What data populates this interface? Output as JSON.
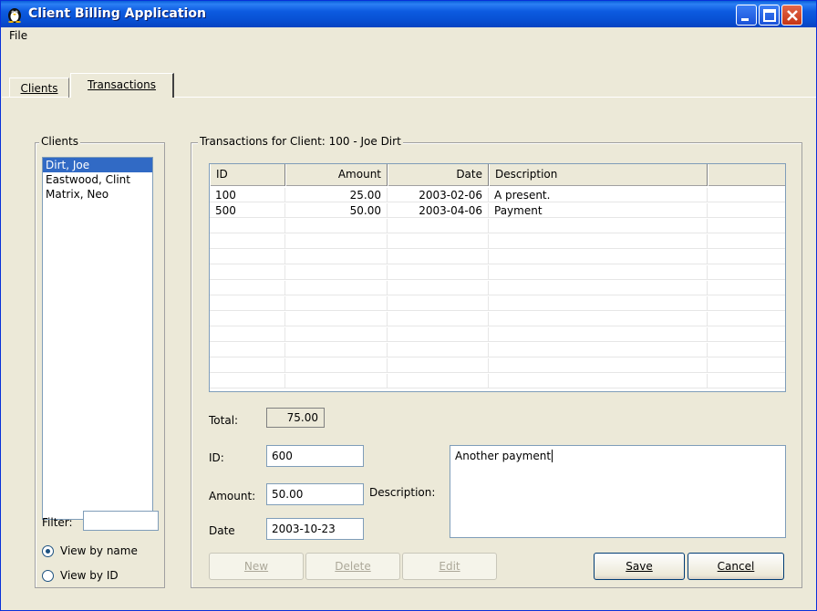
{
  "window": {
    "title": "Client Billing Application",
    "icon": "penguin-icon"
  },
  "menu": {
    "file": "File"
  },
  "tabs": [
    {
      "label": "Clients",
      "selected": false
    },
    {
      "label": "Transactions",
      "selected": true
    }
  ],
  "clients": {
    "legend": "Clients",
    "items": [
      "Dirt, Joe",
      "Eastwood, Clint",
      "Matrix, Neo"
    ],
    "selected_index": 0,
    "filter_label": "Filter:",
    "filter_value": "",
    "radio_name": "View by name",
    "radio_id": "View by ID",
    "view_by": "name"
  },
  "transactions": {
    "legend": "Transactions for Client: 100 - Joe Dirt",
    "columns": [
      "ID",
      "Amount",
      "Date",
      "Description"
    ],
    "rows": [
      {
        "id": "100",
        "amount": "25.00",
        "date": "2003-02-06",
        "description": "A present."
      },
      {
        "id": "500",
        "amount": "50.00",
        "date": "2003-04-06",
        "description": "Payment"
      }
    ],
    "total_label": "Total:",
    "total_value": "75.00",
    "id_label": "ID:",
    "id_value": "600",
    "amount_label": "Amount:",
    "amount_value": "50.00",
    "date_label": "Date",
    "date_value": "2003-10-23",
    "description_label": "Description:",
    "description_value": "Another payment"
  },
  "buttons": {
    "new": "New",
    "delete": "Delete",
    "edit": "Edit",
    "save": "Save",
    "cancel": "Cancel"
  },
  "colors": {
    "titlebar": "#0a5fd8",
    "selection": "#316ac5",
    "background": "#ece9d8"
  }
}
